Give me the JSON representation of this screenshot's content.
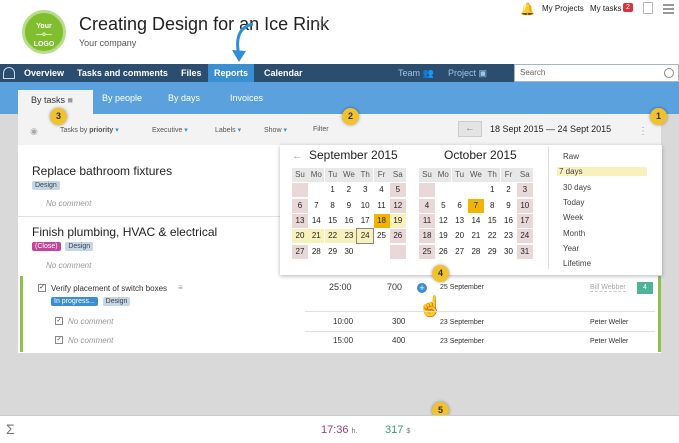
{
  "header": {
    "logo_lines": [
      "Your",
      "LOGO"
    ],
    "title": "Creating Design for an Ice Rink",
    "company": "Your company",
    "my_projects": "My Projects",
    "my_tasks": "My tasks",
    "tasks_badge": "2"
  },
  "nav": {
    "items": [
      "Overview",
      "Tasks and comments",
      "Files",
      "Reports",
      "Calendar"
    ],
    "active": "Reports",
    "team": "Team",
    "project": "Project",
    "search_placeholder": "Search"
  },
  "subnav": {
    "items": [
      "By tasks",
      "By people",
      "By days",
      "Invoices"
    ],
    "active": "By tasks"
  },
  "filter": {
    "tasks_by": "Tasks by",
    "priority": "priority",
    "executive": "Executive",
    "labels": "Labels",
    "show": "Show",
    "filter": "Filter",
    "date_range": "18 Sept 2015 — 24 Sept 2015"
  },
  "tasks": [
    {
      "title": "Replace bathroom fixtures",
      "tags": [
        "Design"
      ],
      "comment": "No comment"
    },
    {
      "title": "Finish plumbing, HVAC & electrical",
      "tags": [
        "(Close)",
        "Design"
      ],
      "comment": "No comment"
    }
  ],
  "subtask": {
    "title": "Verify placement of switch boxes",
    "tags": [
      "In progress...",
      "Design"
    ],
    "hours": "25:00",
    "amount": "700",
    "date": "25 September",
    "assignee": "Bill Webber",
    "badge": "4",
    "entries": [
      {
        "comment": "No comment",
        "hours": "10:00",
        "amount": "300",
        "date": "23 September",
        "person": "Peter Weller"
      },
      {
        "comment": "No comment",
        "hours": "15:00",
        "amount": "400",
        "date": "23 September",
        "person": "Peter Weller"
      }
    ]
  },
  "calendar": {
    "month1": "September 2015",
    "month2": "October 2015",
    "weekdays": [
      "Su",
      "Mo",
      "Tu",
      "We",
      "Th",
      "Fr",
      "Sa"
    ],
    "sept_weeks": [
      [
        "",
        "",
        "1",
        "2",
        "3",
        "4",
        "5"
      ],
      [
        "6",
        "7",
        "8",
        "9",
        "10",
        "11",
        "12"
      ],
      [
        "13",
        "14",
        "15",
        "16",
        "17",
        "18",
        "19"
      ],
      [
        "20",
        "21",
        "22",
        "23",
        "24",
        "25",
        "26"
      ],
      [
        "27",
        "28",
        "29",
        "30",
        "",
        "",
        ""
      ]
    ],
    "oct_weeks": [
      [
        "",
        "",
        "",
        "",
        "1",
        "2",
        "3"
      ],
      [
        "4",
        "5",
        "6",
        "7",
        "8",
        "9",
        "10"
      ],
      [
        "11",
        "12",
        "13",
        "14",
        "15",
        "16",
        "17"
      ],
      [
        "18",
        "19",
        "20",
        "21",
        "22",
        "23",
        "24"
      ],
      [
        "25",
        "26",
        "27",
        "28",
        "29",
        "30",
        "31"
      ]
    ],
    "presets": [
      "Raw",
      "7 days",
      "30 days",
      "Today",
      "Week",
      "Month",
      "Year",
      "Lifetime"
    ],
    "active_preset": "7 days"
  },
  "markers": [
    "1",
    "2",
    "3",
    "4",
    "5"
  ],
  "footer": {
    "hours": "17:36",
    "hours_unit": "h.",
    "amount": "317",
    "amount_unit": "$"
  }
}
